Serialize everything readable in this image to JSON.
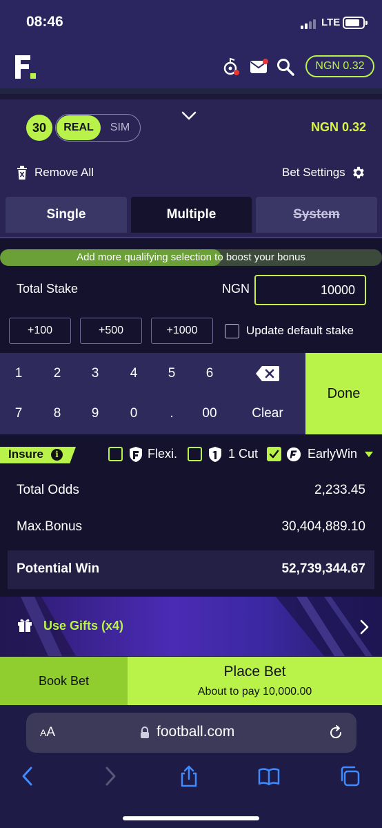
{
  "status_bar": {
    "time": "08:46",
    "network": "LTE"
  },
  "header": {
    "balance": "NGN 0.32"
  },
  "betslip": {
    "selection_count": "30",
    "mode_real": "REAL",
    "mode_sim": "SIM",
    "balance": "NGN 0.32",
    "remove_all": "Remove All",
    "bet_settings": "Bet Settings",
    "tabs": [
      {
        "label": "Single",
        "active": false,
        "disabled": false
      },
      {
        "label": "Multiple",
        "active": true,
        "disabled": false
      },
      {
        "label": "System",
        "active": false,
        "disabled": true
      }
    ],
    "boost_message": "Add more qualifying selection to boost your bonus",
    "boost_progress": 0.58,
    "total_stake_label": "Total Stake",
    "currency": "NGN",
    "stake_value": "10000",
    "quick_stakes": [
      "+100",
      "+500",
      "+1000"
    ],
    "update_default_stake": "Update default stake",
    "update_default_checked": false,
    "keypad": {
      "row1": [
        "1",
        "2",
        "3",
        "4",
        "5",
        "6"
      ],
      "row2": [
        "7",
        "8",
        "9",
        "0",
        ".",
        "00"
      ],
      "clear": "Clear",
      "done": "Done"
    },
    "insure": {
      "label": "Insure",
      "info_icon": "i",
      "options": [
        {
          "label": "Flexi.",
          "checked": false
        },
        {
          "label": "1 Cut",
          "checked": false
        },
        {
          "label": "EarlyWin",
          "checked": true
        }
      ]
    },
    "summary": {
      "total_odds_label": "Total Odds",
      "total_odds": "2,233.45",
      "max_bonus_label": "Max.Bonus",
      "max_bonus": "30,404,889.10",
      "potential_win_label": "Potential Win",
      "potential_win": "52,739,344.67"
    },
    "gifts": "Use Gifts (x4)",
    "book_bet": "Book Bet",
    "place_bet": "Place Bet",
    "place_bet_sub": "About to pay 10,000.00"
  },
  "browser": {
    "text_size": "AA",
    "url": "football.com"
  },
  "colors": {
    "accent": "#b9f34a",
    "header_bg": "#2b2660",
    "panel_bg": "#15122e",
    "keypad_bg": "#2f2a5c"
  }
}
